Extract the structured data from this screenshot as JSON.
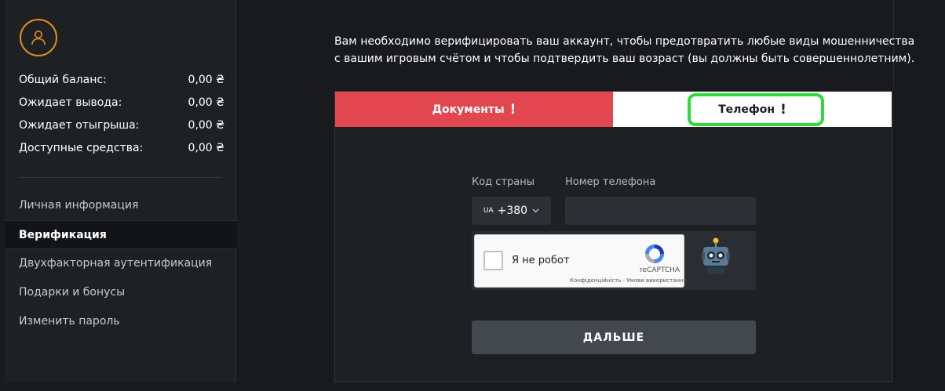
{
  "balances": [
    {
      "label": "Общий баланс:",
      "value": "0,00 ₴"
    },
    {
      "label": "Ожидает вывода:",
      "value": "0,00 ₴"
    },
    {
      "label": "Ожидает отыгрыша:",
      "value": "0,00 ₴"
    },
    {
      "label": "Доступные средства:",
      "value": "0,00 ₴"
    }
  ],
  "nav": [
    {
      "label": "Личная информация",
      "active": false
    },
    {
      "label": "Верификация",
      "active": true
    },
    {
      "label": "Двухфакторная аутентификация",
      "active": false
    },
    {
      "label": "Подарки и бонусы",
      "active": false
    },
    {
      "label": "Изменить пароль",
      "active": false
    }
  ],
  "intro_text": "Вам необходимо верифицировать ваш аккаунт, чтобы предотвратить любые виды мошенничества с вашим игровым счётом и чтобы подтвердить ваш возраст (вы должны быть совершеннолетним).",
  "tabs": {
    "documents": {
      "label": "Документы",
      "flag": "!"
    },
    "phone": {
      "label": "Телефон",
      "flag": "!"
    }
  },
  "form": {
    "country_label": "Код страны",
    "phone_label": "Номер телефона",
    "country_code": "UA",
    "country_dial": "+380",
    "phone_value": "",
    "phone_placeholder": ""
  },
  "recaptcha": {
    "label": "Я не робот",
    "brand": "reCAPTCHA",
    "links": "Конфіденційність - Умови використання"
  },
  "submit_label": "ДАЛЬШЕ",
  "colors": {
    "accent_red": "#e2474f",
    "avatar_orange": "#e68a1f",
    "highlight_green": "#2bdc3a",
    "background": "#181a1d",
    "panel": "#1e2124"
  },
  "icons": {
    "avatar": "user-icon",
    "country_dropdown": "chevron-down-icon",
    "captcha_logo": "recaptcha-icon",
    "mascot": "robot-icon"
  }
}
